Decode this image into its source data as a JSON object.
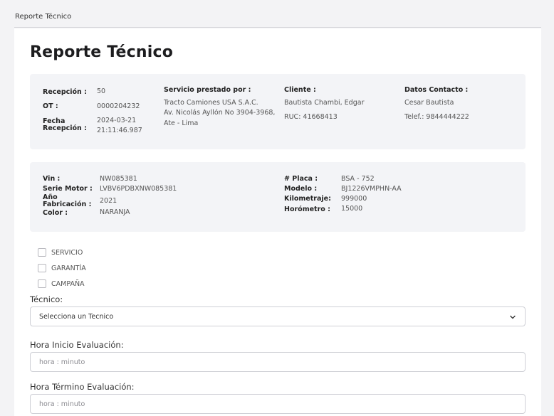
{
  "breadcrumb": "Reporte Técnico",
  "title": "Reporte Técnico",
  "reception": {
    "recepcion_label": "Recepción :",
    "recepcion_value": "50",
    "ot_label": "OT :",
    "ot_value": "0000204232",
    "fecha_label_line1": "Fecha",
    "fecha_label_line2": "Recepción :",
    "fecha_date": "2024-03-21",
    "fecha_time": "21:11:46.987",
    "servicio_label": "Servicio prestado por :",
    "servicio_line1": "Tracto Camiones USA S.A.C.",
    "servicio_line2": "Av. Nicolás Ayllón No 3904-3968,",
    "servicio_line3": "Ate - Lima",
    "cliente_label": "Cliente :",
    "cliente_name": "Bautista Chambi, Edgar",
    "cliente_ruc": "RUC: 41668413",
    "contacto_label": "Datos Contacto :",
    "contacto_name": "Cesar Bautista",
    "contacto_phone": "Telef.: 9844444222"
  },
  "vehicle": {
    "vin_label": "Vin :",
    "vin_value": "NW085381",
    "serie_label": "Serie Motor :",
    "serie_value": "LVBV6PDBXNW085381",
    "anio_label_line1": "Año",
    "anio_label_line2": "Fabricación :",
    "anio_value": "2021",
    "color_label": "Color :",
    "color_value": "NARANJA",
    "placa_label": "# Placa :",
    "placa_value": "BSA - 752",
    "modelo_label": "Modelo :",
    "modelo_value": "BJ1226VMPHN-AA",
    "km_label": "Kilometraje:",
    "km_value": "999000",
    "horometro_label": "Horómetro :",
    "horometro_value": "15000"
  },
  "options": [
    "SERVICIO",
    "GARANTÍA",
    "CAMPAÑA"
  ],
  "form": {
    "tecnico_label": "Técnico:",
    "tecnico_selected": "Selecciona un Tecnico",
    "inicio_label": "Hora Inicio Evaluación:",
    "inicio_placeholder": "hora : minuto",
    "termino_label": "Hora Término Evaluación:",
    "termino_placeholder": "hora : minuto"
  },
  "icons": {
    "dropdown": "chevron-down-icon"
  }
}
